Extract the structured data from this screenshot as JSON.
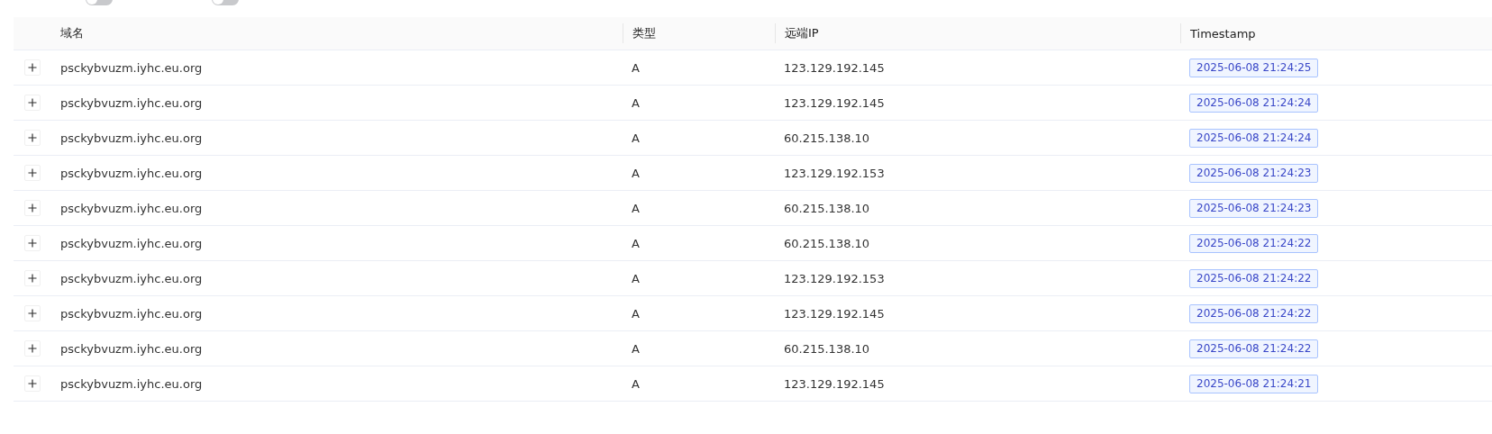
{
  "toolbar": {
    "switches": [
      {
        "on": false
      },
      {
        "on": false
      }
    ]
  },
  "table": {
    "columns": [
      "域名",
      "类型",
      "远端IP",
      "Timestamp"
    ],
    "rows": [
      {
        "domain": "psckybvuzm.iyhc.eu.org",
        "type": "A",
        "ip": "123.129.192.145",
        "timestamp": "2025-06-08 21:24:25"
      },
      {
        "domain": "psckybvuzm.iyhc.eu.org",
        "type": "A",
        "ip": "123.129.192.145",
        "timestamp": "2025-06-08 21:24:24"
      },
      {
        "domain": "psckybvuzm.iyhc.eu.org",
        "type": "A",
        "ip": "60.215.138.10",
        "timestamp": "2025-06-08 21:24:24"
      },
      {
        "domain": "psckybvuzm.iyhc.eu.org",
        "type": "A",
        "ip": "123.129.192.153",
        "timestamp": "2025-06-08 21:24:23"
      },
      {
        "domain": "psckybvuzm.iyhc.eu.org",
        "type": "A",
        "ip": "60.215.138.10",
        "timestamp": "2025-06-08 21:24:23"
      },
      {
        "domain": "psckybvuzm.iyhc.eu.org",
        "type": "A",
        "ip": "60.215.138.10",
        "timestamp": "2025-06-08 21:24:22"
      },
      {
        "domain": "psckybvuzm.iyhc.eu.org",
        "type": "A",
        "ip": "123.129.192.153",
        "timestamp": "2025-06-08 21:24:22"
      },
      {
        "domain": "psckybvuzm.iyhc.eu.org",
        "type": "A",
        "ip": "123.129.192.145",
        "timestamp": "2025-06-08 21:24:22"
      },
      {
        "domain": "psckybvuzm.iyhc.eu.org",
        "type": "A",
        "ip": "60.215.138.10",
        "timestamp": "2025-06-08 21:24:22"
      },
      {
        "domain": "psckybvuzm.iyhc.eu.org",
        "type": "A",
        "ip": "123.129.192.145",
        "timestamp": "2025-06-08 21:24:21"
      }
    ]
  }
}
